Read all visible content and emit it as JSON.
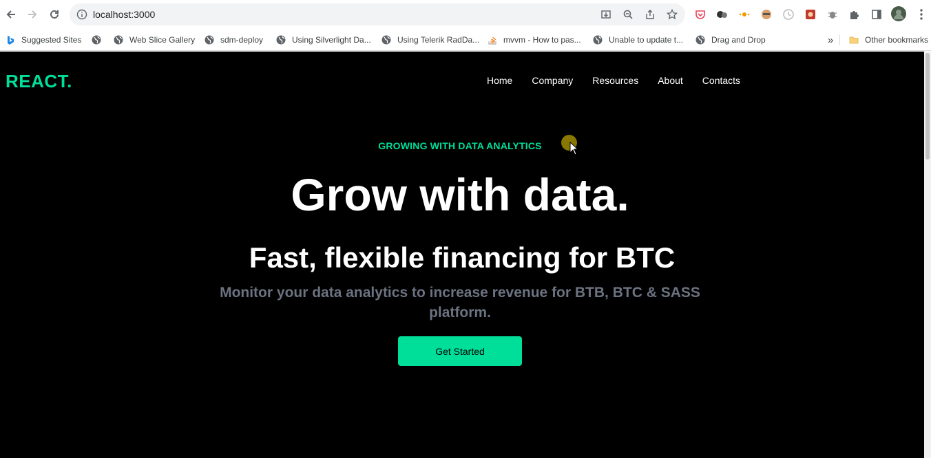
{
  "browser": {
    "url": "localhost:3000",
    "bookmarks": [
      {
        "label": "Suggested Sites"
      },
      {
        "label": ""
      },
      {
        "label": "Web Slice Gallery"
      },
      {
        "label": "sdm-deploy"
      },
      {
        "label": "Using Silverlight Da..."
      },
      {
        "label": "Using Telerik RadDa..."
      },
      {
        "label": "mvvm - How to pas..."
      },
      {
        "label": "Unable to update t..."
      },
      {
        "label": "Drag and Drop"
      }
    ],
    "overflow": "»",
    "other_bookmarks": "Other bookmarks"
  },
  "site": {
    "logo": "REACT.",
    "nav": [
      "Home",
      "Company",
      "Resources",
      "About",
      "Contacts"
    ],
    "kicker": "GROWING WITH DATA ANALYTICS",
    "headline": "Grow with data.",
    "subhead": "Fast, flexible financing for BTC",
    "description": "Monitor your data analytics to increase revenue for BTB, BTC & SASS platform.",
    "cta": "Get Started"
  },
  "colors": {
    "accent": "#00df9a",
    "background": "#000000",
    "muted_text": "#6b7280"
  }
}
